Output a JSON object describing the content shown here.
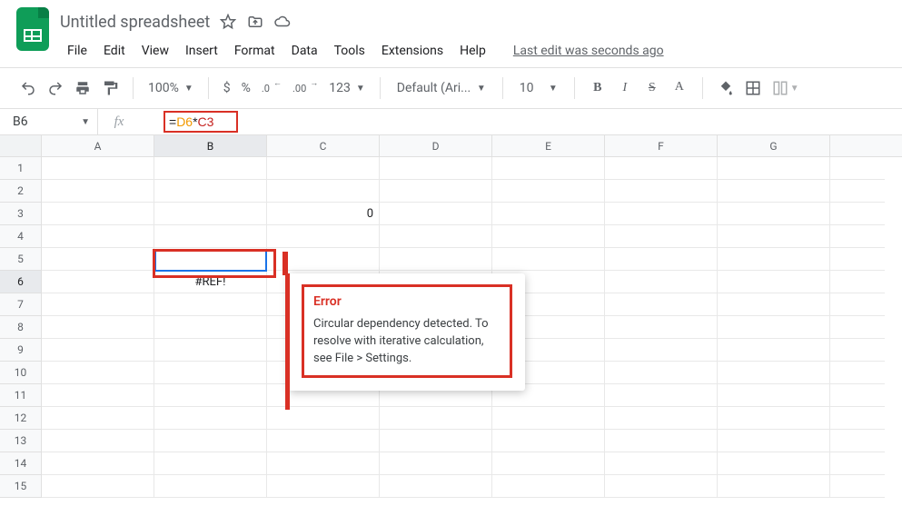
{
  "header": {
    "doc_title": "Untitled spreadsheet",
    "last_edit": "Last edit was seconds ago"
  },
  "menubar": {
    "items": [
      "File",
      "Edit",
      "View",
      "Insert",
      "Format",
      "Data",
      "Tools",
      "Extensions",
      "Help"
    ]
  },
  "toolbar": {
    "zoom": "100%",
    "currency": "$",
    "percent": "%",
    "dec_decrease": ".0",
    "dec_increase": ".00",
    "more_formats": "123",
    "font": "Default (Ari...",
    "font_size": "10",
    "bold": "B",
    "italic": "I",
    "strike": "S",
    "text_color": "A"
  },
  "formula_bar": {
    "namebox": "B6",
    "fx_symbol": "fx",
    "formula_eq": "=",
    "formula_ref1": "D6",
    "formula_op": "*",
    "formula_ref2": "C3"
  },
  "sheet": {
    "columns": [
      "A",
      "B",
      "C",
      "D",
      "E",
      "F",
      "G"
    ],
    "num_rows": 15,
    "values": {
      "C3": "0",
      "B6": "#REF!"
    }
  },
  "error_tooltip": {
    "title": "Error",
    "body": "Circular dependency detected. To resolve with iterative calculation, see File > Settings."
  }
}
